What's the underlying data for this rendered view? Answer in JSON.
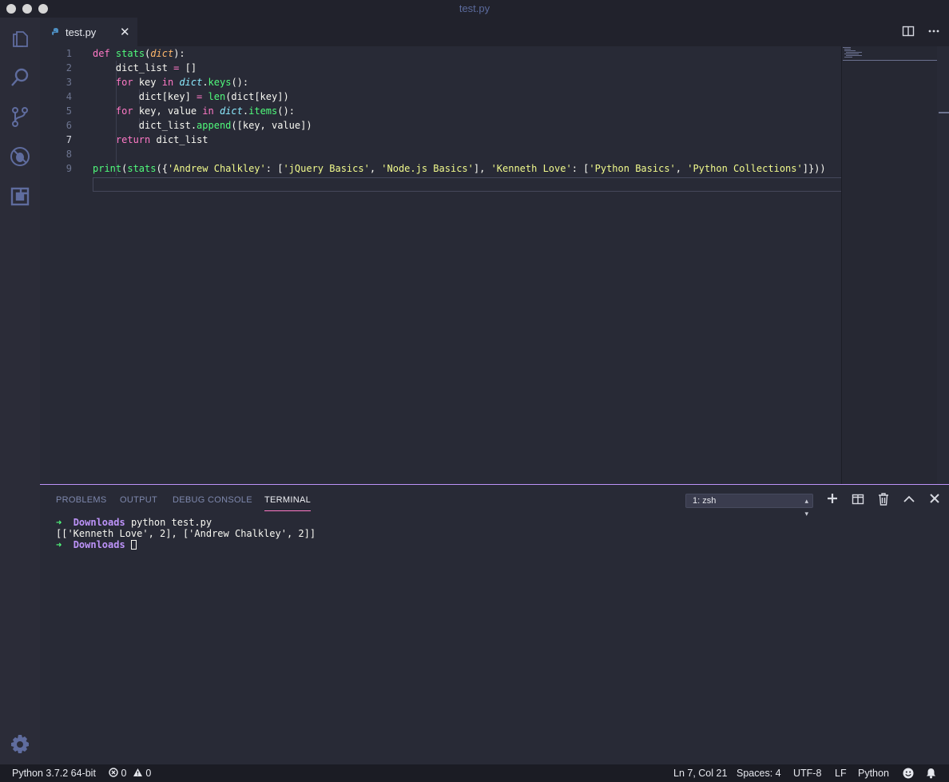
{
  "window": {
    "title": "test.py"
  },
  "tabs": [
    {
      "label": "test.py",
      "close": "✕"
    }
  ],
  "editor": {
    "lines": [
      [
        [
          "k",
          "def"
        ],
        [
          "t",
          " "
        ],
        [
          "f",
          "stats"
        ],
        [
          "t",
          "("
        ],
        [
          "p",
          "dict"
        ],
        [
          "t",
          "):"
        ]
      ],
      [
        [
          "t",
          "    dict_list "
        ],
        [
          "k",
          "="
        ],
        [
          "t",
          " []"
        ]
      ],
      [
        [
          "t",
          "    "
        ],
        [
          "k",
          "for"
        ],
        [
          "t",
          " key "
        ],
        [
          "k",
          "in"
        ],
        [
          "t",
          " "
        ],
        [
          "b",
          "dict"
        ],
        [
          "t",
          "."
        ],
        [
          "f",
          "keys"
        ],
        [
          "t",
          "():"
        ]
      ],
      [
        [
          "t",
          "        dict[key] "
        ],
        [
          "k",
          "="
        ],
        [
          "t",
          " "
        ],
        [
          "f",
          "len"
        ],
        [
          "t",
          "(dict[key])"
        ]
      ],
      [
        [
          "t",
          "    "
        ],
        [
          "k",
          "for"
        ],
        [
          "t",
          " key, value "
        ],
        [
          "k",
          "in"
        ],
        [
          "t",
          " "
        ],
        [
          "b",
          "dict"
        ],
        [
          "t",
          "."
        ],
        [
          "f",
          "items"
        ],
        [
          "t",
          "():"
        ]
      ],
      [
        [
          "t",
          "        dict_list."
        ],
        [
          "f",
          "append"
        ],
        [
          "t",
          "([key, value])"
        ]
      ],
      [
        [
          "t",
          "    "
        ],
        [
          "k",
          "return"
        ],
        [
          "t",
          " dict_list"
        ]
      ],
      [
        [
          "t",
          ""
        ]
      ],
      [
        [
          "f",
          "print"
        ],
        [
          "t",
          "("
        ],
        [
          "f",
          "stats"
        ],
        [
          "t",
          "({"
        ],
        [
          "s",
          "'Andrew Chalkley'"
        ],
        [
          "t",
          ": ["
        ],
        [
          "s",
          "'jQuery Basics'"
        ],
        [
          "t",
          ", "
        ],
        [
          "s",
          "'Node.js Basics'"
        ],
        [
          "t",
          "], "
        ],
        [
          "s",
          "'Kenneth Love'"
        ],
        [
          "t",
          ": ["
        ],
        [
          "s",
          "'Python Basics'"
        ],
        [
          "t",
          ", "
        ],
        [
          "s",
          "'Python Collections'"
        ],
        [
          "t",
          "]}))"
        ]
      ]
    ],
    "line_numbers": [
      "1",
      "2",
      "3",
      "4",
      "5",
      "6",
      "7",
      "8",
      "9"
    ],
    "active_line": "7"
  },
  "panel": {
    "tabs": [
      "PROBLEMS",
      "OUTPUT",
      "DEBUG CONSOLE",
      "TERMINAL"
    ],
    "active_tab": "TERMINAL",
    "terminal_select": "1: zsh",
    "terminal": {
      "prompt_arrow": "➜",
      "dir": "Downloads",
      "command": "python test.py",
      "output": "[['Kenneth Love', 2], ['Andrew Chalkley', 2]]"
    }
  },
  "statusbar": {
    "interpreter": "Python 3.7.2 64-bit",
    "errors": "0",
    "warnings": "0",
    "cursor_pos": "Ln 7, Col 21",
    "spaces": "Spaces: 4",
    "encoding": "UTF-8",
    "eol": "LF",
    "language": "Python"
  },
  "icons": {
    "activity": [
      "files-icon",
      "search-icon",
      "source-control-icon",
      "debug-icon",
      "extensions-icon",
      "settings-gear-icon"
    ],
    "editor_actions": [
      "split-editor-icon",
      "more-actions-icon"
    ],
    "panel_actions": [
      "new-terminal-icon",
      "split-terminal-icon",
      "kill-terminal-icon",
      "maximize-panel-icon",
      "close-panel-icon"
    ]
  },
  "colors": {
    "keyword": "#ff79c6",
    "function": "#50fa7b",
    "string": "#f1fa8c",
    "param": "#ffb86c",
    "builtin": "#8be9fd",
    "accent": "#bd93f9"
  }
}
